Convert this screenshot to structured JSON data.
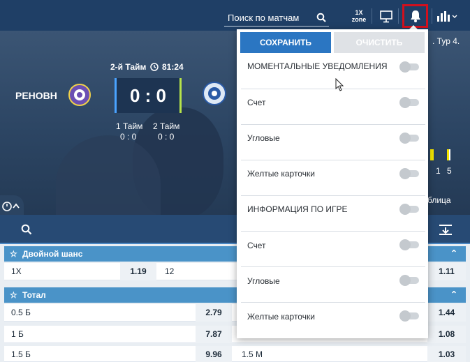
{
  "header": {
    "search_placeholder": "Поиск по матчам",
    "zone_label_top": "1X",
    "zone_label_bottom": "zone"
  },
  "match": {
    "team_home": "РЕНОВН",
    "period": "2-й Тайм",
    "time": "81:24",
    "score": "0 : 0",
    "half1_label": "1 Тайм",
    "half1_score": "0 : 0",
    "half2_label": "2 Тайм",
    "half2_score": "0 : 0",
    "tour": ". Тур 4.",
    "stat_a": "1",
    "stat_b": "5",
    "table_link": "блица"
  },
  "notifications": {
    "save_label": "СОХРАНИТЬ",
    "clear_label": "ОЧИСТИТЬ",
    "options": [
      {
        "label": "МОМЕНТАЛЬНЫЕ УВЕДОМЛЕНИЯ",
        "enabled": false
      },
      {
        "label": "Счет",
        "enabled": false
      },
      {
        "label": "Угловые",
        "enabled": false
      },
      {
        "label": "Желтые карточки",
        "enabled": false
      },
      {
        "label": "ИНФОРМАЦИЯ ПО ИГРЕ",
        "enabled": false
      },
      {
        "label": "Счет",
        "enabled": false
      },
      {
        "label": "Угловые",
        "enabled": false
      },
      {
        "label": "Желтые карточки",
        "enabled": false
      }
    ]
  },
  "markets": {
    "double_chance": {
      "title": "Двойной шанс",
      "row": {
        "c1": "1X",
        "o1": "1.19",
        "c2": "12",
        "o_right": "1.11"
      }
    },
    "total": {
      "title": "Тотал",
      "rows": [
        {
          "c1": "0.5 Б",
          "o1": "2.79",
          "c2": "",
          "o_right": "1.44"
        },
        {
          "c1": "1 Б",
          "o1": "7.87",
          "c2": "",
          "o_right": "1.08"
        },
        {
          "c1": "1.5 Б",
          "o1": "9.96",
          "c2": "1.5 М",
          "o_right": "1.03"
        }
      ]
    }
  },
  "colors": {
    "topbar": "#1f3f66",
    "accent": "#2b76c2",
    "section_header": "#4a93c8",
    "highlight": "#d2101d"
  }
}
